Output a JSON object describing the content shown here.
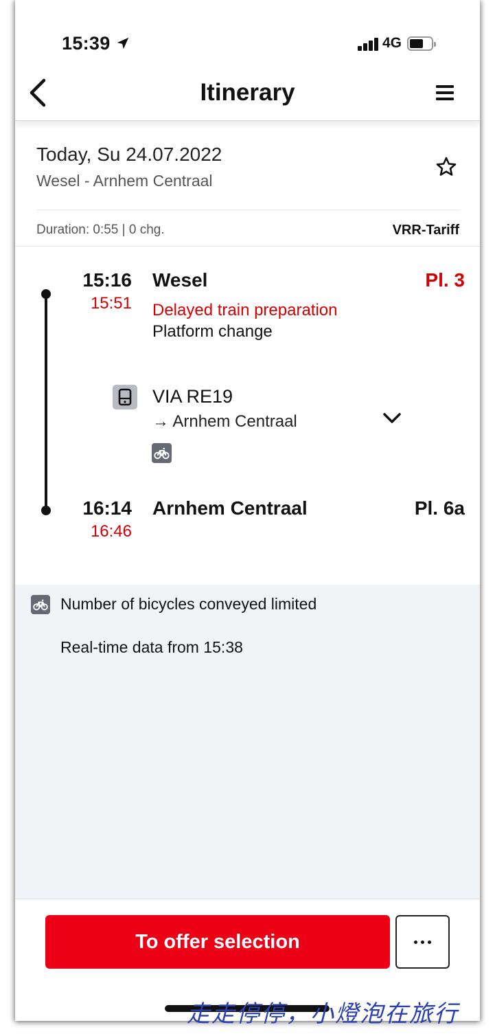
{
  "status_bar": {
    "time": "15:39",
    "location_icon": "location-arrow-icon",
    "network": "4G",
    "signal_icon": "signal-bars-icon",
    "battery_icon": "battery-icon"
  },
  "nav": {
    "title": "Itinerary",
    "back_icon": "chevron-left-icon",
    "menu_icon": "hamburger-menu-icon"
  },
  "summary": {
    "date": "Today, Su 24.07.2022",
    "route": "Wesel - Arnhem Centraal",
    "favorite_icon": "star-outline-icon",
    "duration": "Duration: 0:55 | 0 chg.",
    "tariff": "VRR-Tariff"
  },
  "journey": {
    "departure": {
      "scheduled_time": "15:16",
      "real_time": "15:51",
      "station": "Wesel",
      "platform": "Pl. 3",
      "platform_color": "#d50000",
      "message_delay": "Delayed train preparation",
      "message_change": "Platform change"
    },
    "leg": {
      "vehicle_icon": "train-icon",
      "line": "VIA RE19",
      "direction": "→ Arnhem Centraal",
      "expand_icon": "chevron-down-icon",
      "attribute_icon": "bicycle-icon"
    },
    "arrival": {
      "scheduled_time": "16:14",
      "real_time": "16:46",
      "station": "Arnhem Centraal",
      "platform": "Pl. 6a",
      "platform_color": "#111111"
    }
  },
  "info": {
    "bike_icon": "bicycle-icon",
    "bike_notice": "Number of bicycles conveyed limited",
    "realtime_note": "Real-time data from 15:38"
  },
  "footer": {
    "cta_label": "To offer selection",
    "cta_color": "#ec0016",
    "more_icon": "more-dots-icon"
  },
  "watermark": "走走停停，小燈泡在旅行",
  "colors": {
    "delay_red": "#d50000",
    "info_bg": "#f1f4f7",
    "badge_gray": "#646973"
  }
}
